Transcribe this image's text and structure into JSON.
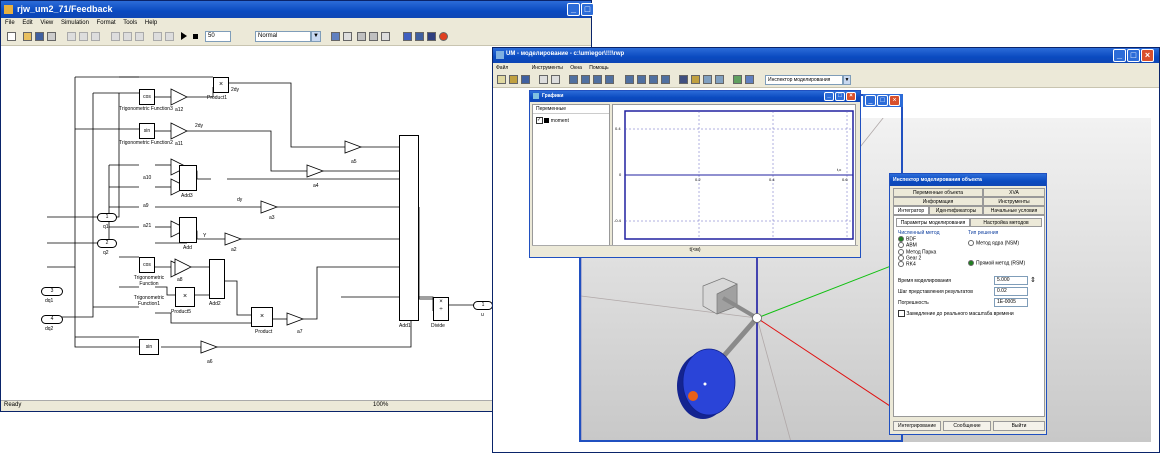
{
  "simulink": {
    "title": "rjw_um2_71/Feedback",
    "menu": [
      "File",
      "Edit",
      "View",
      "Simulation",
      "Format",
      "Tools",
      "Help"
    ],
    "stop_time": "50",
    "mode": "Normal",
    "status": "Ready",
    "zoom": "100%",
    "blocks": {
      "cos1": "cos",
      "sin1": "sin",
      "cos2": "cos",
      "sin2": "sin",
      "cos3": "cos",
      "sin3": "sin",
      "trig3": "Trigonometric Function3",
      "trig2": "Trigonometric Function2",
      "trig": "Trigonometric Function",
      "trig1": "Trigonometric Function1",
      "a12": "a12",
      "a11": "a11",
      "a10": "a10",
      "a9": "a9",
      "a21": "a21",
      "a8": "a8",
      "a5": "a5",
      "a4": "a4",
      "a3": "a3",
      "a2": "a2",
      "a7": "a7",
      "a6": "a6",
      "product1": "Product1",
      "product5": "Product5",
      "product": "Product",
      "add3": "Add3",
      "add": "Add",
      "add2": "Add2",
      "add1": "Add1",
      "divide": "Divide",
      "dy1": "2dy",
      "dy2": "2dy",
      "dy3": "dy",
      "y": "Y",
      "in1": "1",
      "in1_name": "q1",
      "in2": "2",
      "in2_name": "q2",
      "in3": "3",
      "in3_name": "dq1",
      "in4": "4",
      "in4_name": "dq2",
      "out1": "1",
      "out1_name": "u"
    }
  },
  "um": {
    "title": "UM - моделирование - c:\\um\\egor\\!!!\\rwp",
    "menu": [
      "Файл",
      "Инструменты",
      "Окна",
      "Помощь"
    ],
    "toolbar_combo": "Инспектор моделирования",
    "graph": {
      "title": "Графики",
      "vars_header": "Переменные",
      "var_name": "moment",
      "yticks": [
        "0.4",
        "0",
        "-0.4"
      ],
      "xticks": [
        "0.2",
        "0.4",
        "0.6"
      ],
      "xlabel": "t,c",
      "footer": "t(<м)"
    },
    "inspector": {
      "title": "Инспектор моделирования объекта",
      "tabs_row1": [
        "Переменные объекта",
        "XVA"
      ],
      "tabs_row2": [
        "Информация",
        "Инструменты"
      ],
      "tabs_row3": [
        "Интегратор",
        "Идентификаторы",
        "Начальные условия"
      ],
      "subtabs": [
        "Параметры моделирования",
        "Настройка методов"
      ],
      "method_group": "Численный метод",
      "methods": [
        "BDF",
        "ABM",
        "Метод Парка",
        "Gear 2",
        "RK4"
      ],
      "type_group": "Тип решения",
      "types": [
        "Метод ядра (NSM)",
        "Прямой метод (RSM)"
      ],
      "time_label": "Время моделирования",
      "time_value": "5.000",
      "step_label": "Шаг представления результатов",
      "step_value": "0.02",
      "tol_label": "Погрешность",
      "tol_value": "1E-0005",
      "realtime_label": "Замедление до реального масштаба времени",
      "btn_integrate": "Интегрирование",
      "btn_message": "Сообщение",
      "btn_exit": "Выйти"
    }
  }
}
